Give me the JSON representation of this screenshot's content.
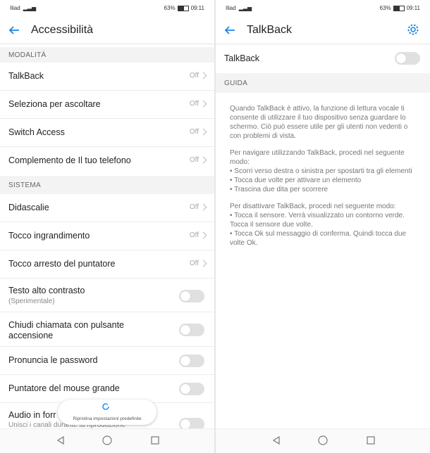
{
  "left": {
    "status": {
      "carrier": "Iliad",
      "battery": "63%",
      "time": "09:11"
    },
    "header": {
      "title": "Accessibilità"
    },
    "sections": {
      "modalita": "MODALITÀ",
      "sistema": "SISTEMA"
    },
    "items": [
      {
        "label": "TalkBack",
        "value": "Off"
      },
      {
        "label": "Seleziona per ascoltare",
        "value": "Off"
      },
      {
        "label": "Switch Access",
        "value": "Off"
      },
      {
        "label": "Complemento de Il tuo telefono",
        "value": "Off"
      },
      {
        "label": "Didascalie",
        "value": "Off"
      },
      {
        "label": "Tocco ingrandimento",
        "value": "Off"
      },
      {
        "label": "Tocco arresto del puntatore",
        "value": "Off"
      },
      {
        "label": "Testo alto contrasto",
        "sub": "(Sperimentale)"
      },
      {
        "label": "Chiudi chiamata con pulsante",
        "label2": "accensione"
      },
      {
        "label": "Pronuncia le password"
      },
      {
        "label": "Puntatore del mouse grande"
      },
      {
        "label": "Audio in forr",
        "sub": "Unisci i canali durante la riproduzione"
      }
    ],
    "toast": "Ripristina impostazioni predefinite"
  },
  "right": {
    "status": {
      "carrier": "Iliad",
      "battery": "63%",
      "time": "09:11"
    },
    "header": {
      "title": "TalkBack"
    },
    "talkback_label": "TalkBack",
    "section": "GUIDA",
    "guide": {
      "p1": "Quando TalkBack è attivo, la funzione di lettura vocale ti consente di utilizzare il tuo dispositivo senza guardare lo schermo. Ciò può essere utile per gli utenti non vedenti o con problemi di vista.",
      "p2_intro": "Per navigare utilizzando TalkBack, procedi nel seguente modo:",
      "p2_b1": "• Scorri verso destra o sinistra per spostarti tra gli elementi",
      "p2_b2": "• Tocca due volte per attivare un elemento",
      "p2_b3": "• Trascina due dita per scorrere",
      "p3_intro": "Per disattivare TalkBack, procedi nel seguente modo:",
      "p3_b1": "• Tocca il sensore. Verrà visualizzato un contorno verde. Tocca il sensore due volte.",
      "p3_b2": "• Tocca Ok sul messaggio di conferma. Quindi tocca due volte Ok."
    }
  },
  "colors": {
    "accent": "#1e88e5",
    "toggle_off": "#e0e0e0",
    "section_bg": "#f3f3f3"
  },
  "icons": [
    "back-arrow-icon",
    "gear-icon",
    "chevron-right-icon",
    "nav-back-icon",
    "nav-home-icon",
    "nav-recents-icon",
    "refresh-icon"
  ]
}
